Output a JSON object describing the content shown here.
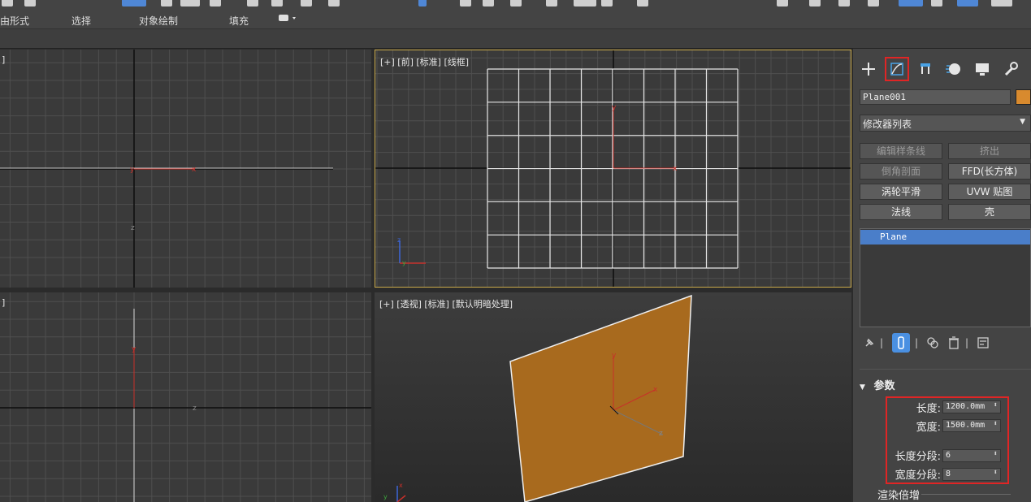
{
  "ribbon": {
    "items": [
      "由形式",
      "选择",
      "对象绘制",
      "填充"
    ]
  },
  "viewports": {
    "front_label": "[+] [前] [标准] [线框]",
    "perspective_label": "[+] [透视] [标准] [默认明暗处理]",
    "top_left_label": "]",
    "bottom_left_label": "]",
    "axis": {
      "x": "x",
      "y": "y",
      "z": "z"
    },
    "plane_color": "#a86a1e",
    "grid_color": "#4f4f4f",
    "active_border_color": "#c9a94a"
  },
  "panel": {
    "tabs": [
      "create-icon",
      "modify-icon",
      "hierarchy-icon",
      "motion-icon",
      "display-icon",
      "utilities-icon"
    ],
    "object_name": "Plane001",
    "object_color": "#d88a2e",
    "modifier_list": "修改器列表",
    "modifier_buttons": [
      "编辑样条线",
      "挤出",
      "倒角剖面",
      "FFD(长方体)",
      "涡轮平滑",
      "UVW 贴图",
      "法线",
      "壳"
    ],
    "stack_item": "Plane",
    "params_title": "参数",
    "length_label": "长度:",
    "length_value": "1200.0mm",
    "width_label": "宽度:",
    "width_value": "1500.0mm",
    "length_segs_label": "长度分段:",
    "length_segs_value": "6",
    "width_segs_label": "宽度分段:",
    "width_segs_value": "8",
    "render_multiplier_label": "渲染倍增",
    "highlight_color": "#e02525"
  }
}
